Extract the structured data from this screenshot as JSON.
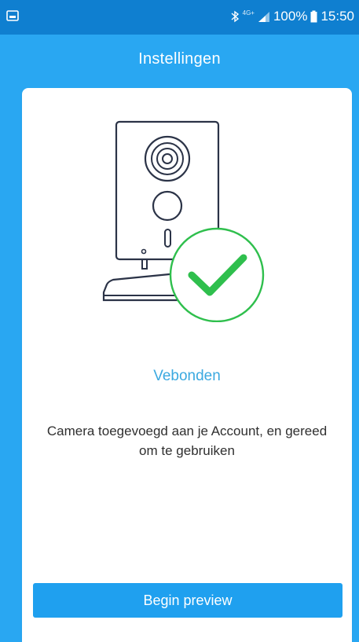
{
  "status_bar": {
    "left_icon": "image-notification-icon",
    "bluetooth_icon": "bluetooth-icon",
    "network_type": "4G+",
    "signal_icon": "signal-icon",
    "battery_percent": "100%",
    "battery_icon": "battery-icon",
    "time": "15:50"
  },
  "appbar": {
    "title": "Instellingen"
  },
  "main": {
    "illustration": "camera-connected-icon",
    "status_label": "Vebonden",
    "description": "Camera toegevoegd aan je Account, en gereed om te gebruiken",
    "button_label": "Begin preview"
  },
  "colors": {
    "status_bar": "#0f7fd0",
    "appbar": "#29a7f2",
    "accent": "#1fa0ef",
    "success": "#2fbf4d",
    "label_blue": "#3ba9e0"
  }
}
